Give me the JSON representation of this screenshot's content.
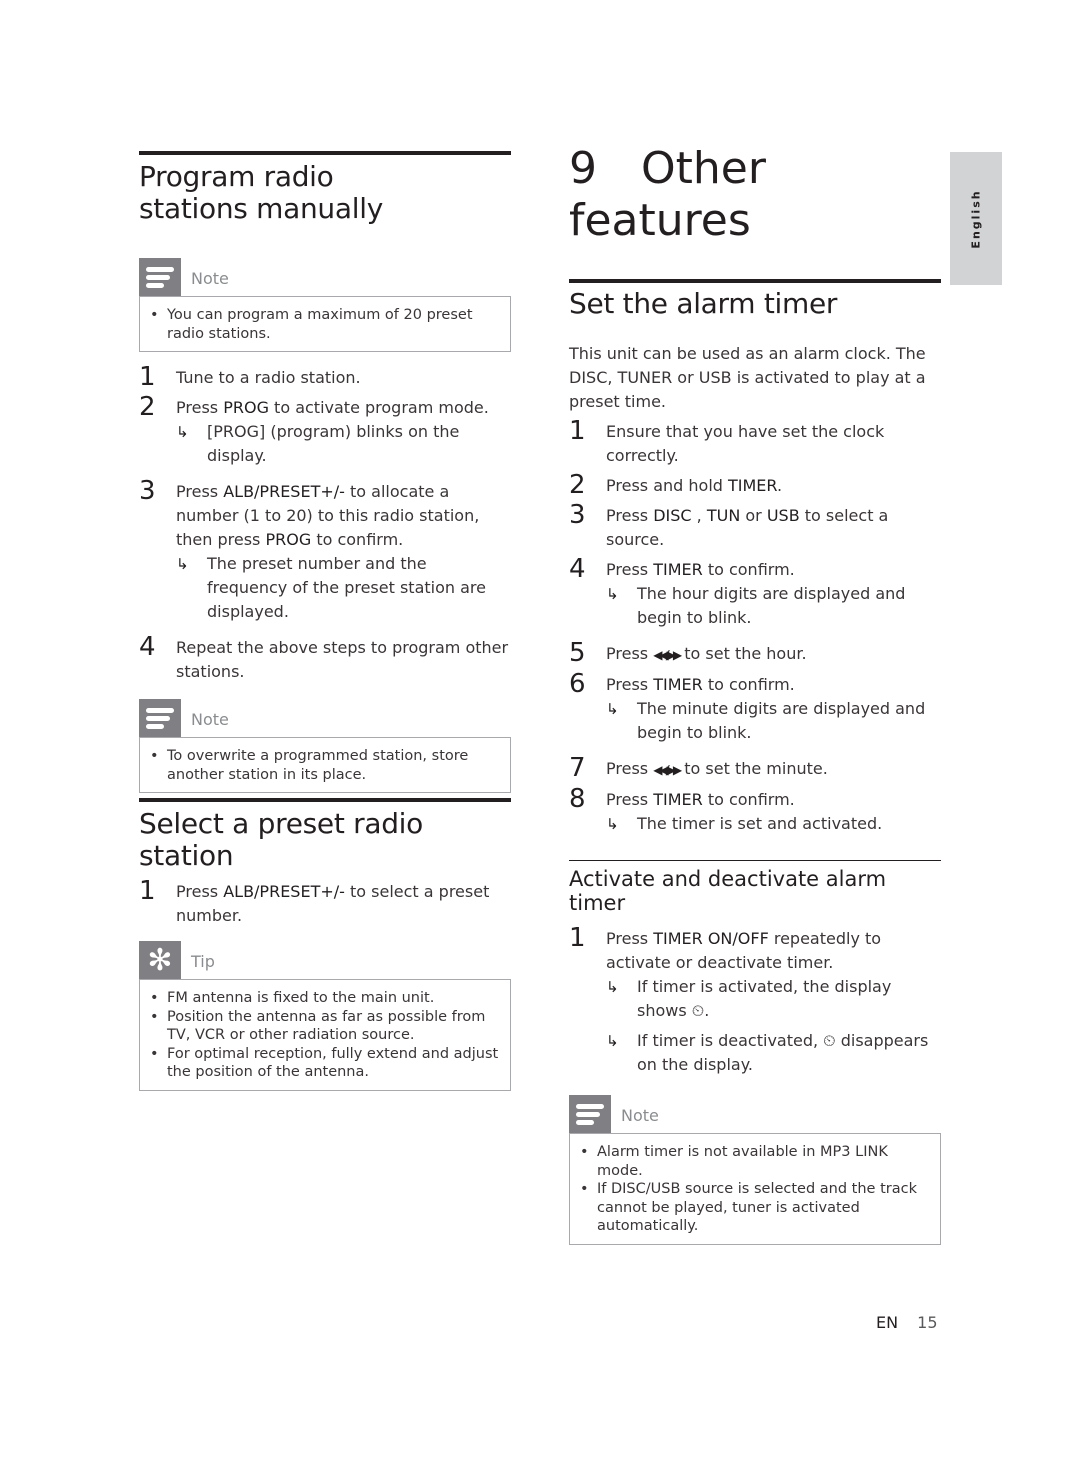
{
  "left": {
    "section1": {
      "title": "Program radio stations manually",
      "note1": {
        "label": "Note",
        "items": [
          "You can program a maximum of 20 preset radio stations."
        ]
      },
      "steps": [
        {
          "num": "1",
          "parts": [
            {
              "t": "Tune to a radio station."
            }
          ],
          "results": []
        },
        {
          "num": "2",
          "parts": [
            {
              "t": "Press "
            },
            {
              "b": "PROG"
            },
            {
              "t": " to activate program mode."
            }
          ],
          "results": [
            "[PROG] (program) blinks on the display."
          ]
        },
        {
          "num": "3",
          "parts": [
            {
              "t": "Press "
            },
            {
              "b": "ALB/PRESET+/-"
            },
            {
              "t": " to allocate a number (1 to 20) to this radio station, then press "
            },
            {
              "b": "PROG"
            },
            {
              "t": " to confirm."
            }
          ],
          "results": [
            "The preset number and the frequency of the preset station are displayed."
          ]
        },
        {
          "num": "4",
          "parts": [
            {
              "t": "Repeat the above steps to program other stations."
            }
          ],
          "results": []
        }
      ],
      "note2": {
        "label": "Note",
        "items": [
          "To overwrite a programmed station, store another station in its place."
        ]
      }
    },
    "section2": {
      "title": "Select a preset radio station",
      "steps": [
        {
          "num": "1",
          "parts": [
            {
              "t": "Press "
            },
            {
              "b": "ALB/PRESET+/-"
            },
            {
              "t": " to select a preset number."
            }
          ],
          "results": []
        }
      ],
      "tip": {
        "label": "Tip",
        "items": [
          "FM antenna is fixed to the main unit.",
          "Position the antenna as far as possible from TV, VCR or other radiation source.",
          "For optimal reception, fully extend and adjust the position of the antenna."
        ]
      }
    }
  },
  "right": {
    "chapter": {
      "number": "9",
      "title": "Other features"
    },
    "section1": {
      "title": "Set the alarm timer",
      "intro": "This unit can be used as an alarm clock. The DISC, TUNER or USB is activated to play at a preset time.",
      "steps": [
        {
          "num": "1",
          "parts": [
            {
              "t": "Ensure that you have set the clock correctly."
            }
          ],
          "results": []
        },
        {
          "num": "2",
          "parts": [
            {
              "t": "Press and hold "
            },
            {
              "b": "TIMER"
            },
            {
              "t": "."
            }
          ],
          "results": []
        },
        {
          "num": "3",
          "parts": [
            {
              "t": "Press "
            },
            {
              "b": "DISC"
            },
            {
              "t": " , "
            },
            {
              "b": "TUN"
            },
            {
              "t": " or "
            },
            {
              "b": "USB"
            },
            {
              "t": " to select a source."
            }
          ],
          "results": []
        },
        {
          "num": "4",
          "parts": [
            {
              "t": "Press "
            },
            {
              "b": "TIMER"
            },
            {
              "t": " to confirm."
            }
          ],
          "results": [
            "The hour digits are displayed and begin to blink."
          ]
        },
        {
          "num": "5",
          "parts": [
            {
              "t": "Press "
            },
            {
              "i": "◀◀/▶▶"
            },
            {
              "t": " to set the hour."
            }
          ],
          "results": []
        },
        {
          "num": "6",
          "parts": [
            {
              "t": "Press "
            },
            {
              "b": "TIMER"
            },
            {
              "t": " to confirm."
            }
          ],
          "results": [
            "The minute digits are displayed and begin to blink."
          ]
        },
        {
          "num": "7",
          "parts": [
            {
              "t": "Press "
            },
            {
              "i": "◀◀/▶▶"
            },
            {
              "t": " to set the minute."
            }
          ],
          "results": []
        },
        {
          "num": "8",
          "parts": [
            {
              "t": "Press "
            },
            {
              "b": "TIMER"
            },
            {
              "t": " to confirm."
            }
          ],
          "results": [
            "The timer is set and activated."
          ]
        }
      ]
    },
    "section2": {
      "title": "Activate and deactivate alarm timer",
      "steps": [
        {
          "num": "1",
          "parts": [
            {
              "t": "Press "
            },
            {
              "b": "TIMER ON/OFF"
            },
            {
              "t": " repeatedly to activate or deactivate timer."
            }
          ],
          "results": [
            "If timer is activated, the display shows ⏲.",
            "If timer is deactivated, ⏲ disappears on the display."
          ]
        }
      ],
      "note": {
        "label": "Note",
        "items": [
          "Alarm timer is not available in MP3 LINK mode.",
          "If DISC/USB source is selected and the track cannot be played, tuner is activated automatically."
        ]
      }
    }
  },
  "language_tab": "English",
  "footer": {
    "lang": "EN",
    "page": "15"
  }
}
